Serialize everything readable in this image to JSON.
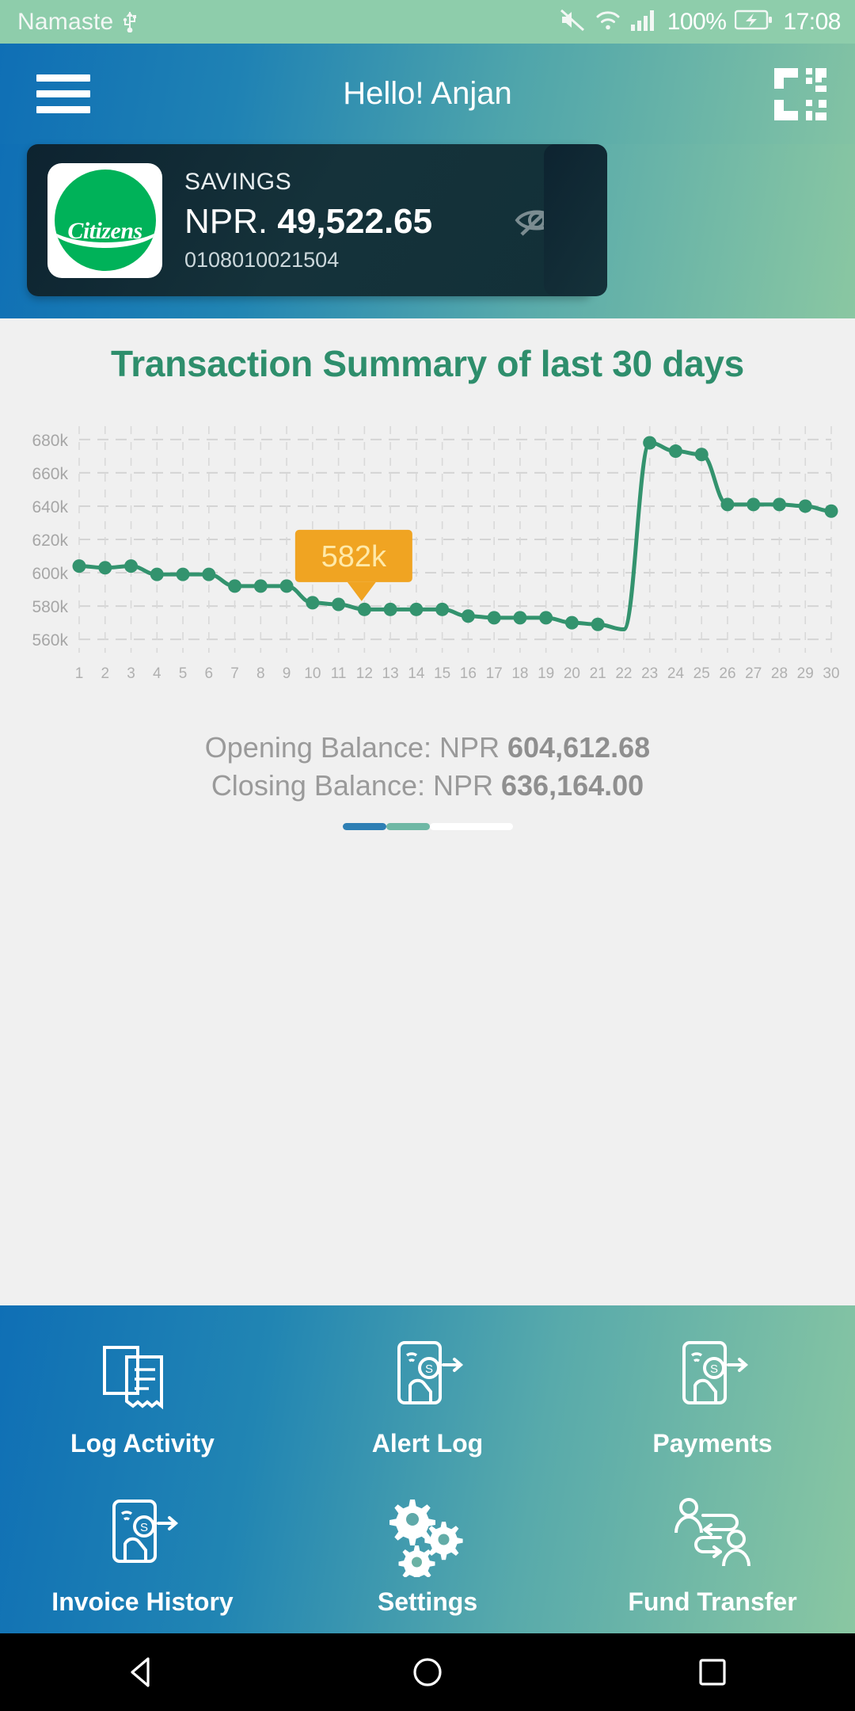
{
  "status_bar": {
    "carrier": "Namaste",
    "usb_icon": "usb-icon",
    "mute_icon": "volume-mute-icon",
    "wifi_icon": "wifi-icon",
    "signal_icon": "cellular-signal-icon",
    "battery_percent": "100%",
    "battery_icon": "battery-charging-icon",
    "time": "17:08"
  },
  "header": {
    "menu_icon": "hamburger-menu-icon",
    "title": "Hello! Anjan",
    "scan_icon": "qr-scan-icon"
  },
  "account_card": {
    "bank_name": "Citizens",
    "account_type": "SAVINGS",
    "currency": "NPR.",
    "balance": "49,522.65",
    "account_number": "0108010021504",
    "hide_balance_icon": "eye-off-icon"
  },
  "summary": {
    "title": "Transaction Summary of last 30 days",
    "opening_label": "Opening Balance: NPR",
    "opening_value": "604,612.68",
    "closing_label": "Closing Balance: NPR",
    "closing_value": "636,164.00"
  },
  "colors": {
    "line": "#33936e",
    "tooltip_bg": "#f0a422",
    "tooltip_text": "#ffe9a8",
    "title_green": "#2e8e6c",
    "card_dark": "#12303a",
    "bank_green": "#00b259"
  },
  "chart_data": {
    "type": "line",
    "title": "Transaction Summary of last 30 days",
    "xlabel": "",
    "ylabel": "",
    "ylim": [
      552,
      688
    ],
    "ytick_labels": [
      "680k",
      "660k",
      "640k",
      "620k",
      "600k",
      "580k",
      "560k"
    ],
    "yticks": [
      680,
      660,
      640,
      620,
      600,
      580,
      560
    ],
    "grid": true,
    "legend": "none",
    "categories": [
      "1",
      "2",
      "3",
      "4",
      "5",
      "6",
      "7",
      "8",
      "9",
      "10",
      "11",
      "12",
      "13",
      "14",
      "15",
      "16",
      "17",
      "18",
      "19",
      "20",
      "21",
      "22",
      "23",
      "24",
      "25",
      "26",
      "27",
      "28",
      "29",
      "30"
    ],
    "values": [
      604,
      603,
      604,
      599,
      599,
      599,
      592,
      592,
      592,
      582,
      581,
      578,
      578,
      578,
      578,
      574,
      573,
      573,
      573,
      570,
      569,
      566,
      678,
      673,
      671,
      641,
      641,
      641,
      640,
      637
    ],
    "annotation": {
      "label": "582k",
      "at_category": "10",
      "value": 582
    },
    "units": "k"
  },
  "nav_grid": {
    "items": [
      {
        "label": "Log Activity",
        "icon": "documents-stack-icon"
      },
      {
        "label": "Alert Log",
        "icon": "mobile-payment-alert-icon"
      },
      {
        "label": "Payments",
        "icon": "mobile-payment-icon"
      },
      {
        "label": "Invoice History",
        "icon": "mobile-invoice-icon"
      },
      {
        "label": "Settings",
        "icon": "gears-settings-icon"
      },
      {
        "label": "Fund Transfer",
        "icon": "people-transfer-icon"
      }
    ]
  },
  "system_nav": {
    "back_icon": "back-triangle-icon",
    "home_icon": "home-circle-icon",
    "recents_icon": "recents-square-icon"
  }
}
